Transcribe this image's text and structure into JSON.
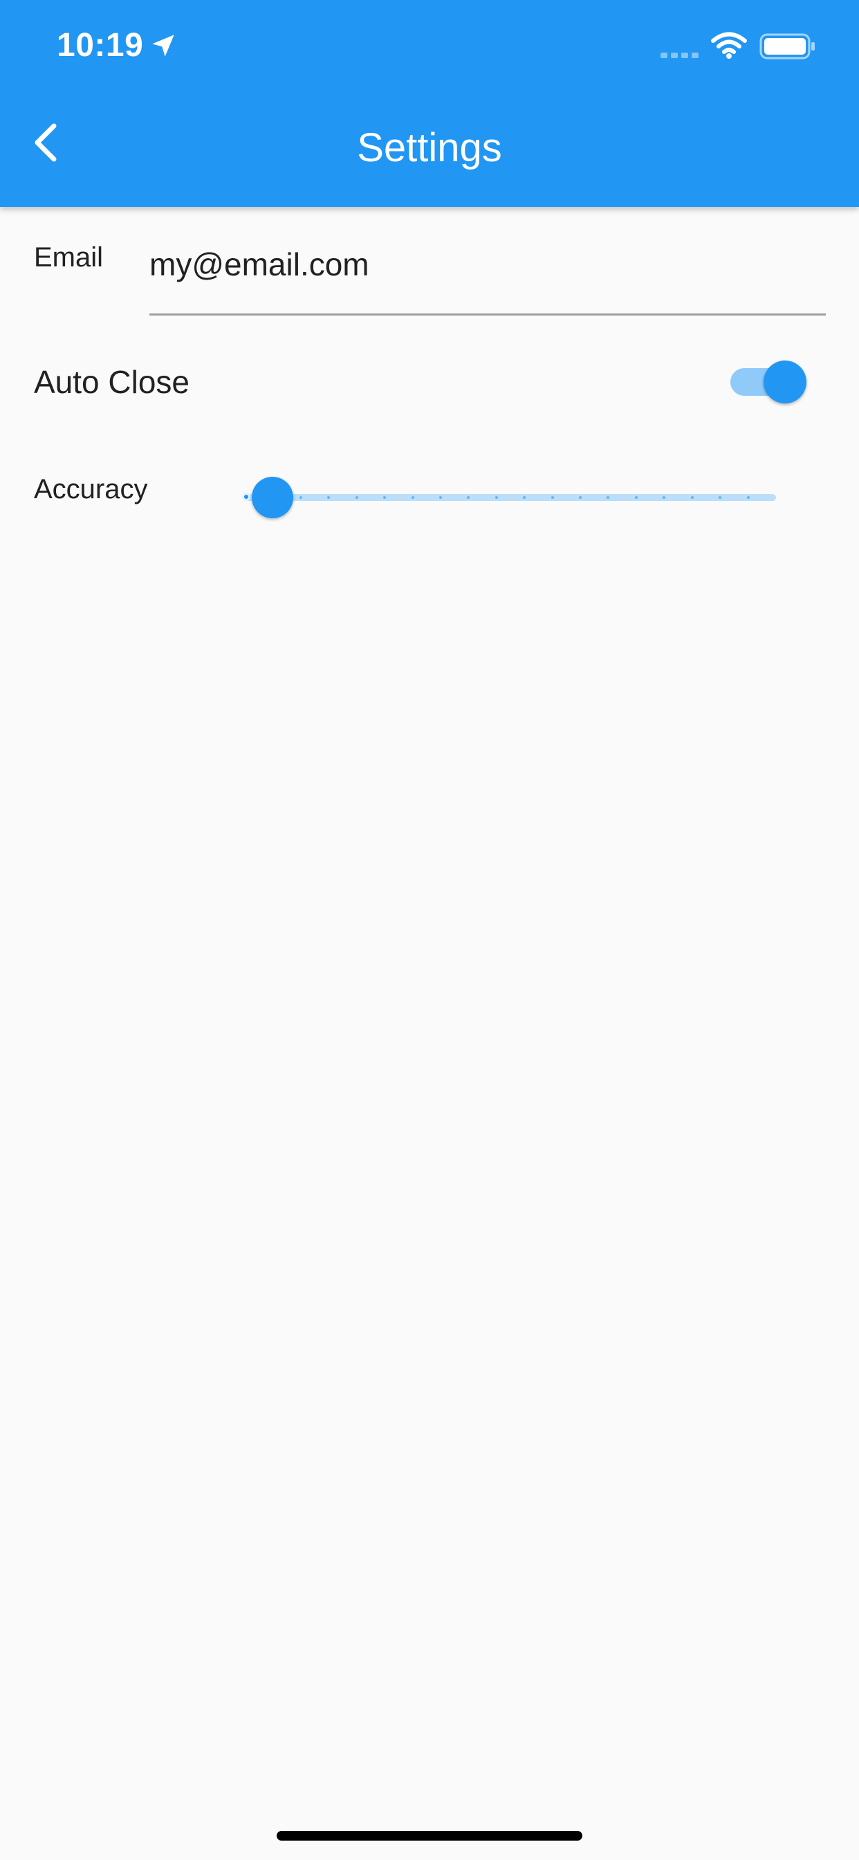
{
  "status_bar": {
    "time": "10:19",
    "icons": [
      "location-arrow-icon",
      "cellular-signal-icon",
      "wifi-icon",
      "battery-icon"
    ]
  },
  "app_bar": {
    "title": "Settings",
    "back_icon": "chevron-left-icon",
    "background_color": "#2196f3"
  },
  "settings": {
    "email": {
      "label": "Email",
      "value": "my@email.com"
    },
    "auto_close": {
      "label": "Auto Close",
      "enabled": true
    },
    "accuracy": {
      "label": "Accuracy",
      "value_fraction": 0.0,
      "divisions": 19
    }
  },
  "colors": {
    "accent": "#2196f3",
    "accent_light": "#90caf9",
    "background": "#fafafa"
  }
}
